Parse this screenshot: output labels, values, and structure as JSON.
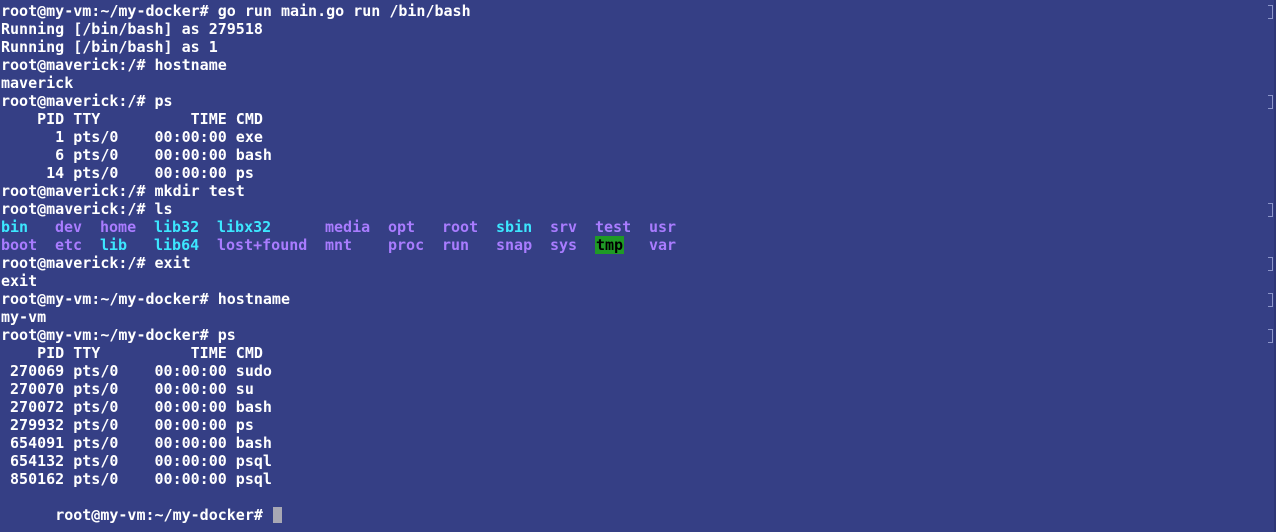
{
  "terminal": {
    "background": "#353f85",
    "text_color": "#ffffff",
    "dir_color": "#3ce7ff",
    "link_color": "#a97cff",
    "highlight_bg": "#1f9a26",
    "lines_before_ls": [
      "root@my-vm:~/my-docker# go run main.go run /bin/bash",
      "Running [/bin/bash] as 279518",
      "Running [/bin/bash] as 1",
      "root@maverick:/# hostname",
      "maverick",
      "root@maverick:/# ps",
      "    PID TTY          TIME CMD",
      "      1 pts/0    00:00:00 exe",
      "      6 pts/0    00:00:00 bash",
      "     14 pts/0    00:00:00 ps",
      "root@maverick:/# mkdir test",
      "root@maverick:/# ls"
    ],
    "ls_rows": [
      [
        {
          "text": "bin",
          "style": "cyan"
        },
        {
          "text": "dev",
          "style": "purple"
        },
        {
          "text": "home",
          "style": "purple"
        },
        {
          "text": "lib32",
          "style": "cyan"
        },
        {
          "text": "libx32",
          "style": "cyan"
        },
        {
          "text": "media",
          "style": "purple"
        },
        {
          "text": "opt",
          "style": "purple"
        },
        {
          "text": "root",
          "style": "purple"
        },
        {
          "text": "sbin",
          "style": "cyan"
        },
        {
          "text": "srv",
          "style": "purple"
        },
        {
          "text": "test",
          "style": "purple"
        },
        {
          "text": "usr",
          "style": "purple"
        }
      ],
      [
        {
          "text": "boot",
          "style": "purple"
        },
        {
          "text": "etc",
          "style": "purple"
        },
        {
          "text": "lib",
          "style": "cyan"
        },
        {
          "text": "lib64",
          "style": "cyan"
        },
        {
          "text": "lost+found",
          "style": "purple"
        },
        {
          "text": "mnt",
          "style": "purple"
        },
        {
          "text": "proc",
          "style": "purple"
        },
        {
          "text": "run",
          "style": "purple"
        },
        {
          "text": "snap",
          "style": "purple"
        },
        {
          "text": "sys",
          "style": "purple"
        },
        {
          "text": "tmp",
          "style": "highlight"
        },
        {
          "text": "var",
          "style": "purple"
        }
      ]
    ],
    "lines_after_ls": [
      "root@maverick:/# exit",
      "exit",
      "root@my-vm:~/my-docker# hostname",
      "my-vm",
      "root@my-vm:~/my-docker# ps",
      "    PID TTY          TIME CMD",
      " 270069 pts/0    00:00:00 sudo",
      " 270070 pts/0    00:00:00 su",
      " 270072 pts/0    00:00:00 bash",
      " 279932 pts/0    00:00:00 ps",
      " 654091 pts/0    00:00:00 bash",
      " 654132 pts/0    00:00:00 psql",
      " 850162 pts/0    00:00:00 psql"
    ],
    "final_prompt": "root@my-vm:~/my-docker# "
  }
}
